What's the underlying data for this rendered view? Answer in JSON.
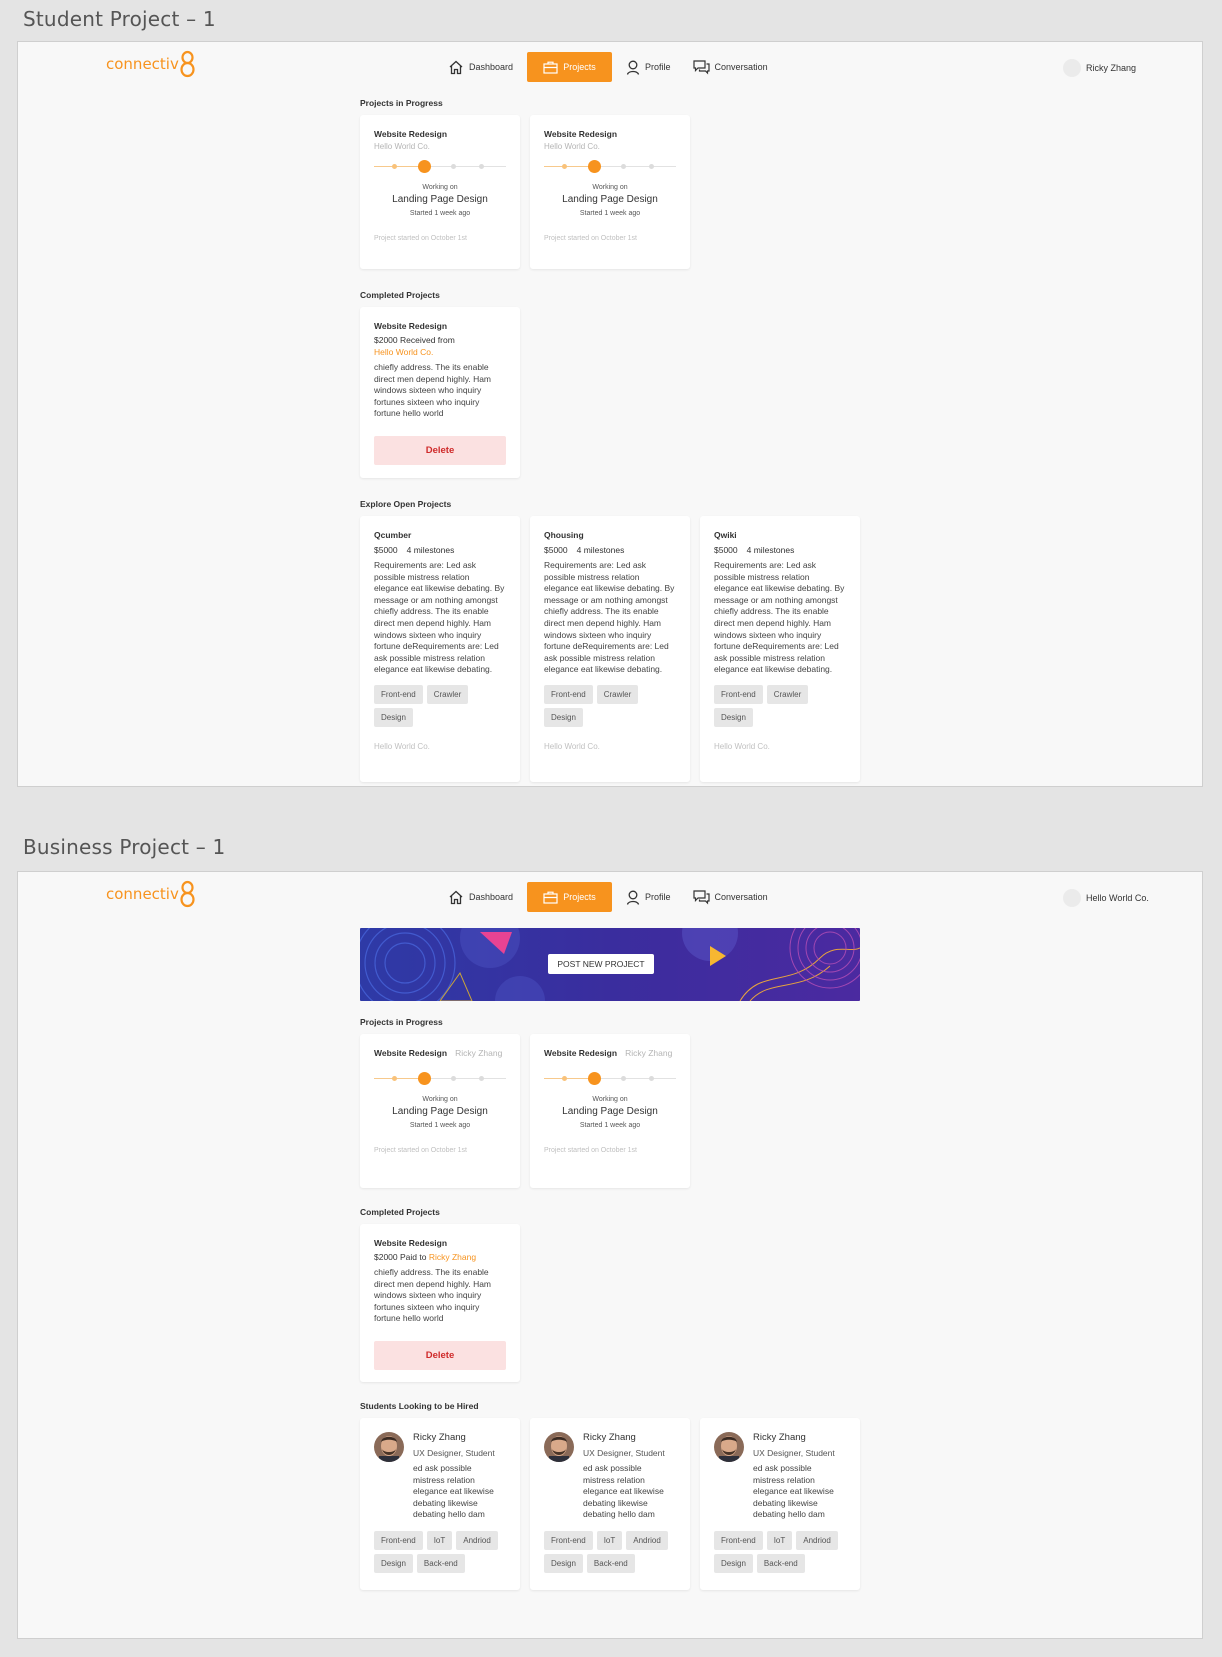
{
  "frames": {
    "student_title": "Student Project – 1",
    "business_title": "Business Project – 1"
  },
  "brand": {
    "logo_text": "connectiv",
    "logo_digit": "8",
    "accent": "#f7931e"
  },
  "nav": {
    "dashboard": "Dashboard",
    "projects": "Projects",
    "profile": "Profile",
    "conversation": "Conversation"
  },
  "student": {
    "user_name": "Ricky Zhang",
    "in_progress_title": "Projects in Progress",
    "in_progress": [
      {
        "title": "Website Redesign",
        "company": "Hello World Co.",
        "working_label": "Working on",
        "milestone": "Landing Page Design",
        "started": "Started 1 week ago",
        "footer": "Project started on October 1st"
      },
      {
        "title": "Website Redesign",
        "company": "Hello World Co.",
        "working_label": "Working on",
        "milestone": "Landing Page Design",
        "started": "Started 1 week ago",
        "footer": "Project started on October 1st"
      }
    ],
    "completed_title": "Completed Projects",
    "completed": {
      "title": "Website Redesign",
      "received": "$2000 Received from",
      "company": "Hello World Co.",
      "description": "chiefly address. The its enable direct men depend highly. Ham windows sixteen who inquiry fortunes sixteen who inquiry fortune hello world",
      "delete_label": "Delete"
    },
    "explore_title": "Explore Open Projects",
    "open_projects": [
      {
        "name": "Qcumber",
        "price": "$5000",
        "milestones": "4 milestones",
        "description": "Requirements are: Led ask possible mistress relation elegance eat likewise debating. By message or am nothing amongst chiefly address. The its enable direct men depend highly. Ham windows sixteen who inquiry fortune deRequirements are: Led ask possible mistress relation elegance eat likewise debating.",
        "tags": [
          "Front-end",
          "Crawler",
          "Design"
        ],
        "company": "Hello World Co."
      },
      {
        "name": "Qhousing",
        "price": "$5000",
        "milestones": "4 milestones",
        "description": "Requirements are: Led ask possible mistress relation elegance eat likewise debating. By message or am nothing amongst chiefly address. The its enable direct men depend highly. Ham windows sixteen who inquiry fortune deRequirements are: Led ask possible mistress relation elegance eat likewise debating.",
        "tags": [
          "Front-end",
          "Crawler",
          "Design"
        ],
        "company": "Hello World Co."
      },
      {
        "name": "Qwiki",
        "price": "$5000",
        "milestones": "4 milestones",
        "description": "Requirements are: Led ask possible mistress relation elegance eat likewise debating. By message or am nothing amongst chiefly address. The its enable direct men depend highly. Ham windows sixteen who inquiry fortune deRequirements are: Led ask possible mistress relation elegance eat likewise debating.",
        "tags": [
          "Front-end",
          "Crawler",
          "Design"
        ],
        "company": "Hello World Co."
      }
    ]
  },
  "business": {
    "user_name": "Hello World Co.",
    "post_button": "POST NEW PROJECT",
    "in_progress_title": "Projects in Progress",
    "in_progress": [
      {
        "title": "Website Redesign",
        "student": "Ricky Zhang",
        "working_label": "Working on",
        "milestone": "Landing Page Design",
        "started": "Started 1 week ago",
        "footer": "Project started on October 1st"
      },
      {
        "title": "Website Redesign",
        "student": "Ricky Zhang",
        "working_label": "Working on",
        "milestone": "Landing Page Design",
        "started": "Started 1 week ago",
        "footer": "Project started on October 1st"
      }
    ],
    "completed_title": "Completed Projects",
    "completed": {
      "title": "Website Redesign",
      "paid": "$2000 Paid to",
      "student": "Ricky Zhang",
      "description": "chiefly address. The its enable direct men depend highly. Ham windows sixteen who inquiry fortunes sixteen who inquiry fortune hello world",
      "delete_label": "Delete"
    },
    "students_title": "Students Looking to be Hired",
    "students": [
      {
        "name": "Ricky Zhang",
        "role": "UX Designer, Student",
        "description": "ed ask possible mistress relation elegance eat likewise debating likewise debating hello dam",
        "tags": [
          "Front-end",
          "IoT",
          "Andriod",
          "Design",
          "Back-end"
        ]
      },
      {
        "name": "Ricky Zhang",
        "role": "UX Designer, Student",
        "description": "ed ask possible mistress relation elegance eat likewise debating likewise debating hello dam",
        "tags": [
          "Front-end",
          "IoT",
          "Andriod",
          "Design",
          "Back-end"
        ]
      },
      {
        "name": "Ricky Zhang",
        "role": "UX Designer, Student",
        "description": "ed ask possible mistress relation elegance eat likewise debating likewise debating hello dam",
        "tags": [
          "Front-end",
          "IoT",
          "Andriod",
          "Design",
          "Back-end"
        ]
      }
    ]
  }
}
